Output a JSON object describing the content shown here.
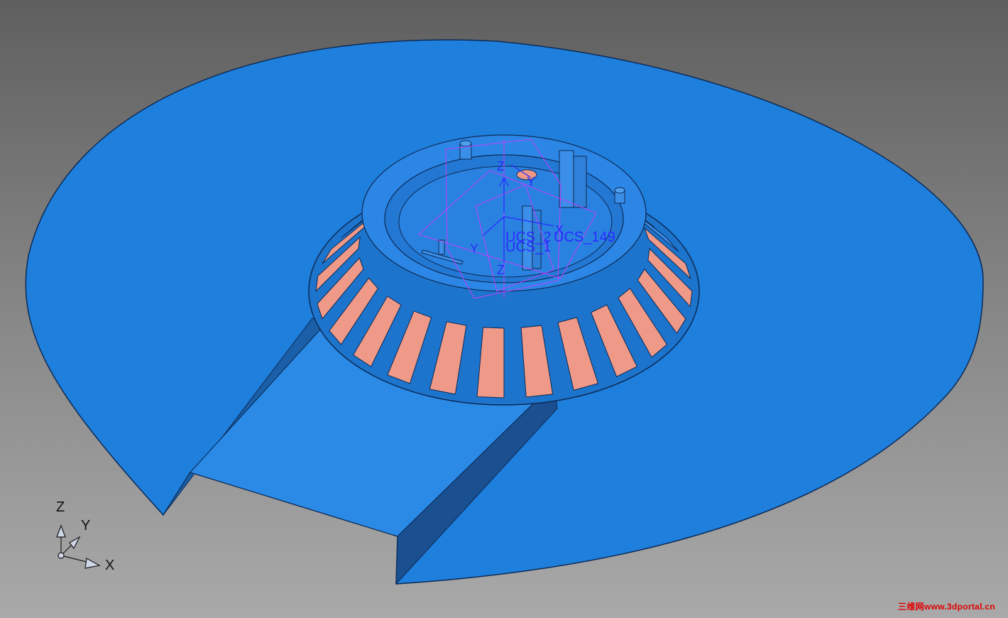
{
  "viewport": {
    "background_top": "#5f5f5f",
    "background_bottom": "#a9a9a9"
  },
  "model": {
    "surface_color": "#1f7fdd",
    "surface_dark": "#1a5fa8",
    "rib_color": "#3a8be6",
    "window_color": "#ef9a88",
    "wire_color": "#c040ff",
    "icon": "cad-model"
  },
  "ucs": {
    "labels": [
      "UCS_2",
      "UCS_1",
      "UCS_149"
    ],
    "axis_z": "Z",
    "axis_y": "Y",
    "axis_x": "X",
    "color": "#2b2bff"
  },
  "csys_triad": {
    "z": "Z",
    "y": "Y",
    "x": "X"
  },
  "watermark": "三维网www.3dportal.cn"
}
